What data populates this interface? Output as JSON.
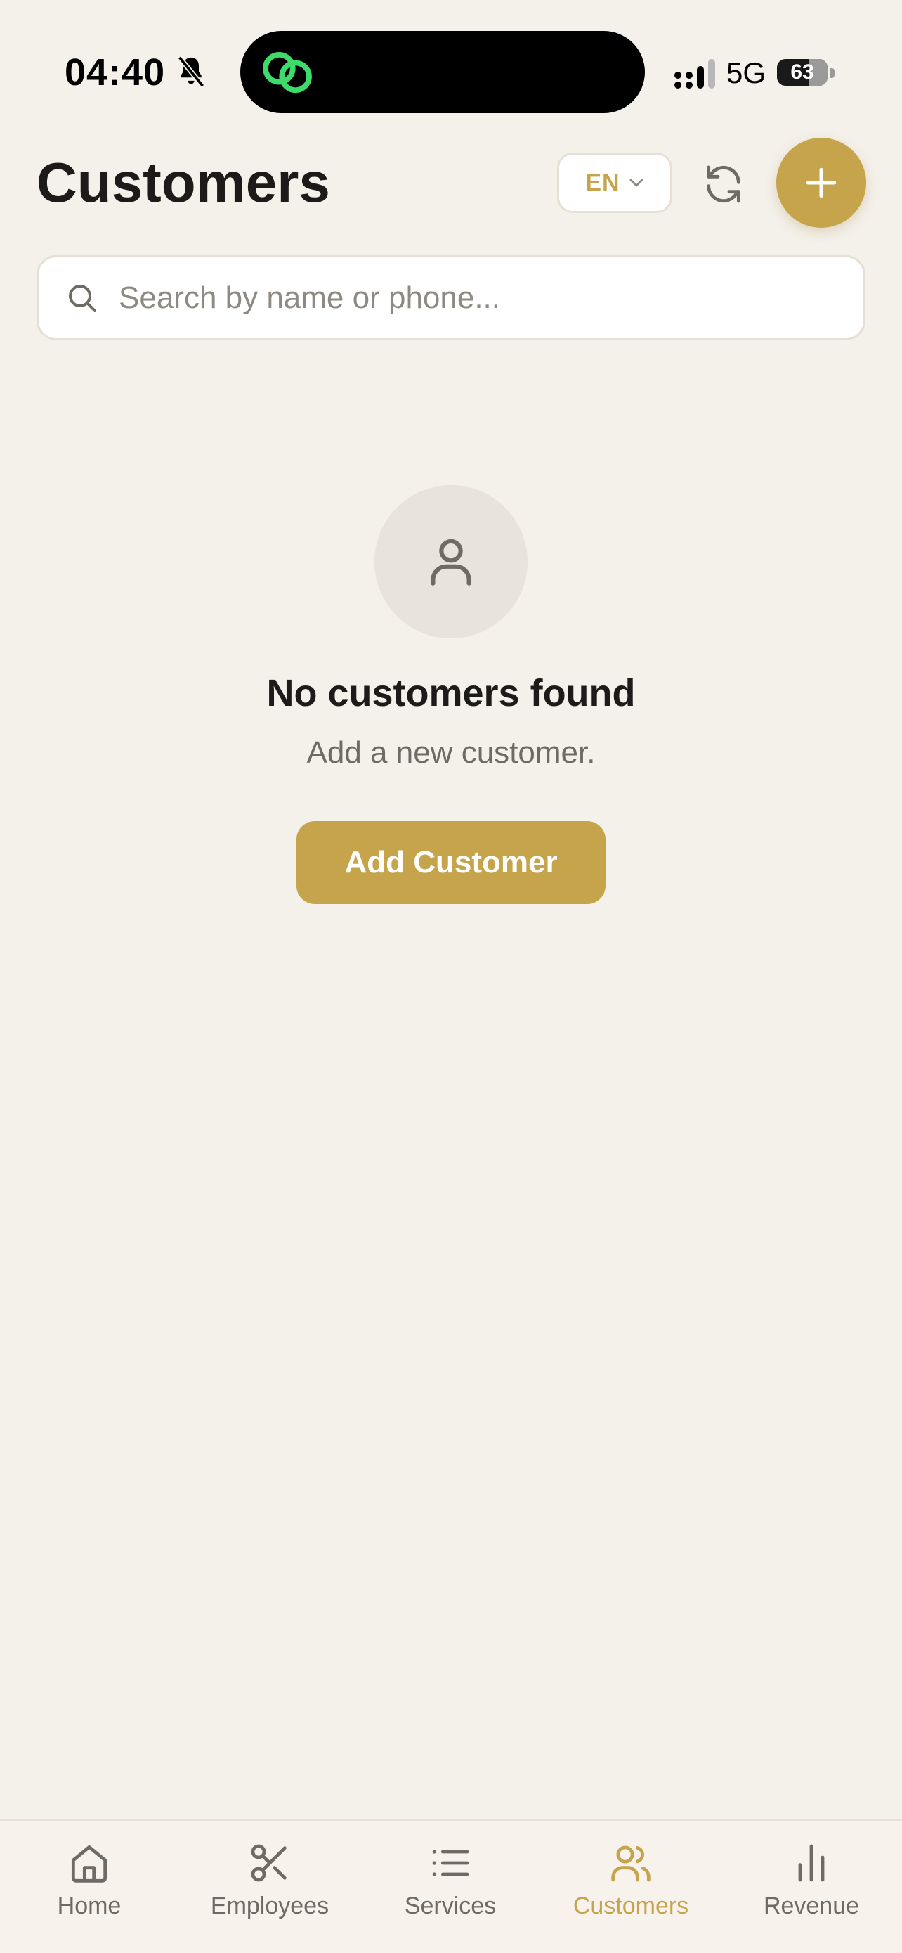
{
  "status_bar": {
    "time": "04:40",
    "network": "5G",
    "battery_percent": 63,
    "battery_label": "63"
  },
  "header": {
    "title": "Customers",
    "language": "EN"
  },
  "search": {
    "placeholder": "Search by name or phone..."
  },
  "empty_state": {
    "title": "No customers found",
    "subtitle": "Add a new customer.",
    "button_label": "Add Customer"
  },
  "tab_bar": {
    "items": [
      {
        "label": "Home",
        "icon": "home-icon",
        "active": false
      },
      {
        "label": "Employees",
        "icon": "scissors-icon",
        "active": false
      },
      {
        "label": "Services",
        "icon": "list-icon",
        "active": false
      },
      {
        "label": "Customers",
        "icon": "users-icon",
        "active": true
      },
      {
        "label": "Revenue",
        "icon": "bar-chart-icon",
        "active": false
      }
    ]
  },
  "colors": {
    "accent": "#C6A44B",
    "background": "#F4F0EA",
    "tab_inactive": "#6E6A64",
    "text_primary": "#1C1B19"
  }
}
